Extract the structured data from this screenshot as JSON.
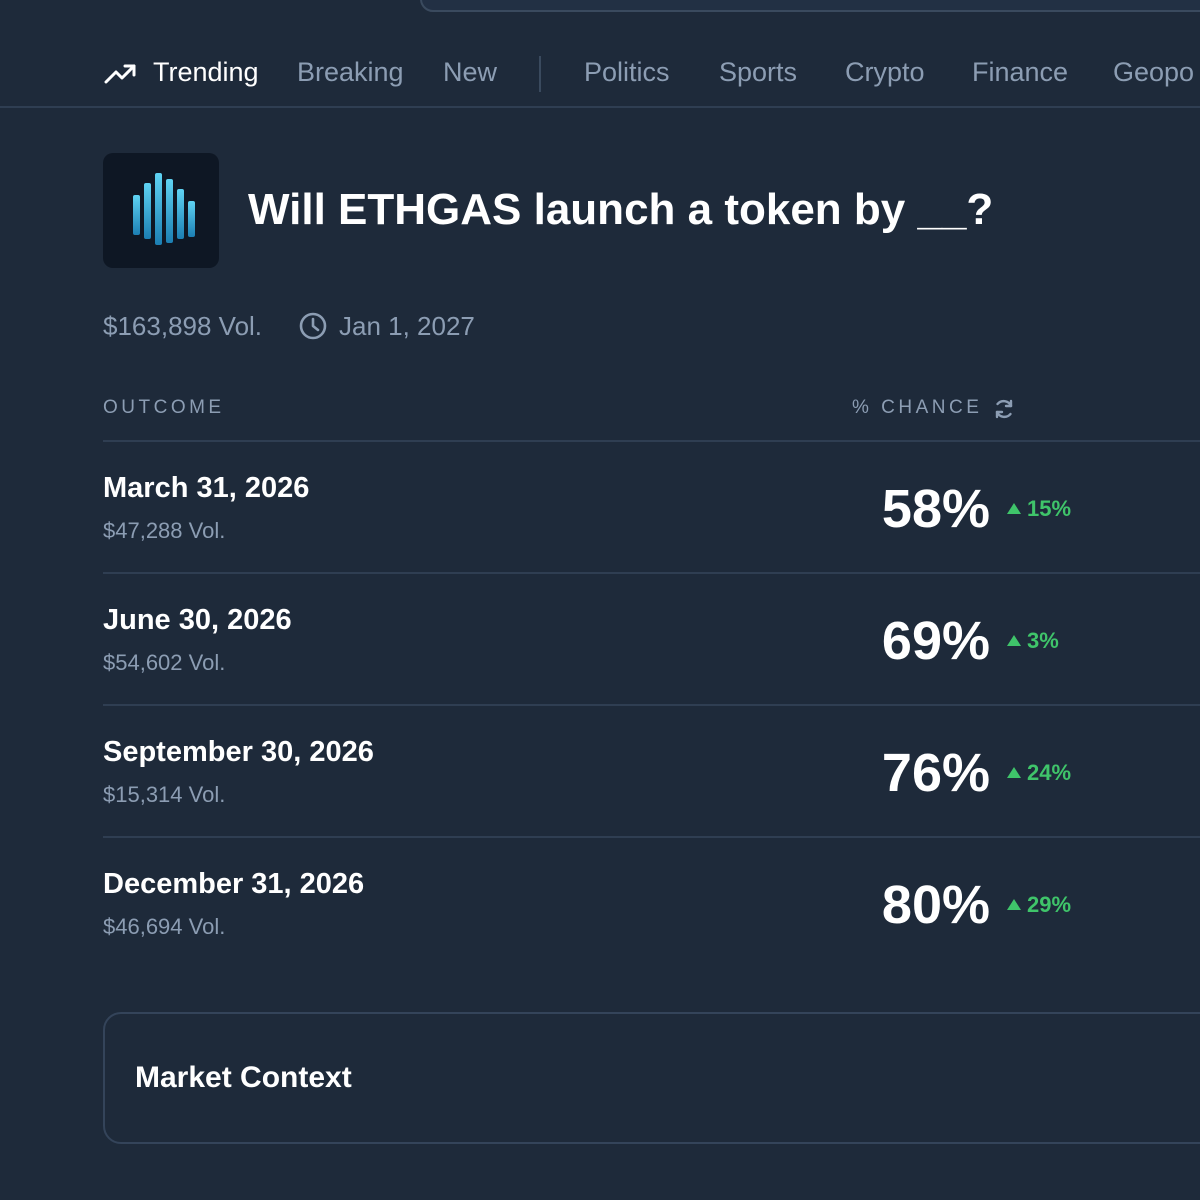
{
  "nav": {
    "items": [
      {
        "label": "Trending",
        "active": true,
        "icon": "trending-up-icon"
      },
      {
        "label": "Breaking"
      },
      {
        "label": "New"
      },
      {
        "label": "Politics"
      },
      {
        "label": "Sports"
      },
      {
        "label": "Crypto"
      },
      {
        "label": "Finance"
      },
      {
        "label": "Geopo"
      }
    ]
  },
  "market": {
    "logo_icon": "ethgas-bars-logo",
    "title": "Will ETHGAS launch a token by __?",
    "volume": "$163,898 Vol.",
    "end_date": "Jan 1, 2027",
    "date_icon": "clock-icon"
  },
  "table": {
    "outcome_header": "OUTCOME",
    "chance_header": "% CHANCE",
    "refresh_icon": "refresh-icon",
    "rows": [
      {
        "label": "March 31, 2026",
        "volume": "$47,288 Vol.",
        "chance": "58%",
        "change": "15%"
      },
      {
        "label": "June 30, 2026",
        "volume": "$54,602 Vol.",
        "chance": "69%",
        "change": "3%"
      },
      {
        "label": "September 30, 2026",
        "volume": "$15,314 Vol.",
        "chance": "76%",
        "change": "24%"
      },
      {
        "label": "December 31, 2026",
        "volume": "$46,694 Vol.",
        "chance": "80%",
        "change": "29%"
      }
    ]
  },
  "context": {
    "title": "Market Context"
  },
  "colors": {
    "background": "#1e2a3a",
    "muted_text": "#8c9db3",
    "positive": "#3fc46a",
    "logo_gradient_top": "#5fd3f3",
    "logo_gradient_bottom": "#1c7fb3"
  }
}
